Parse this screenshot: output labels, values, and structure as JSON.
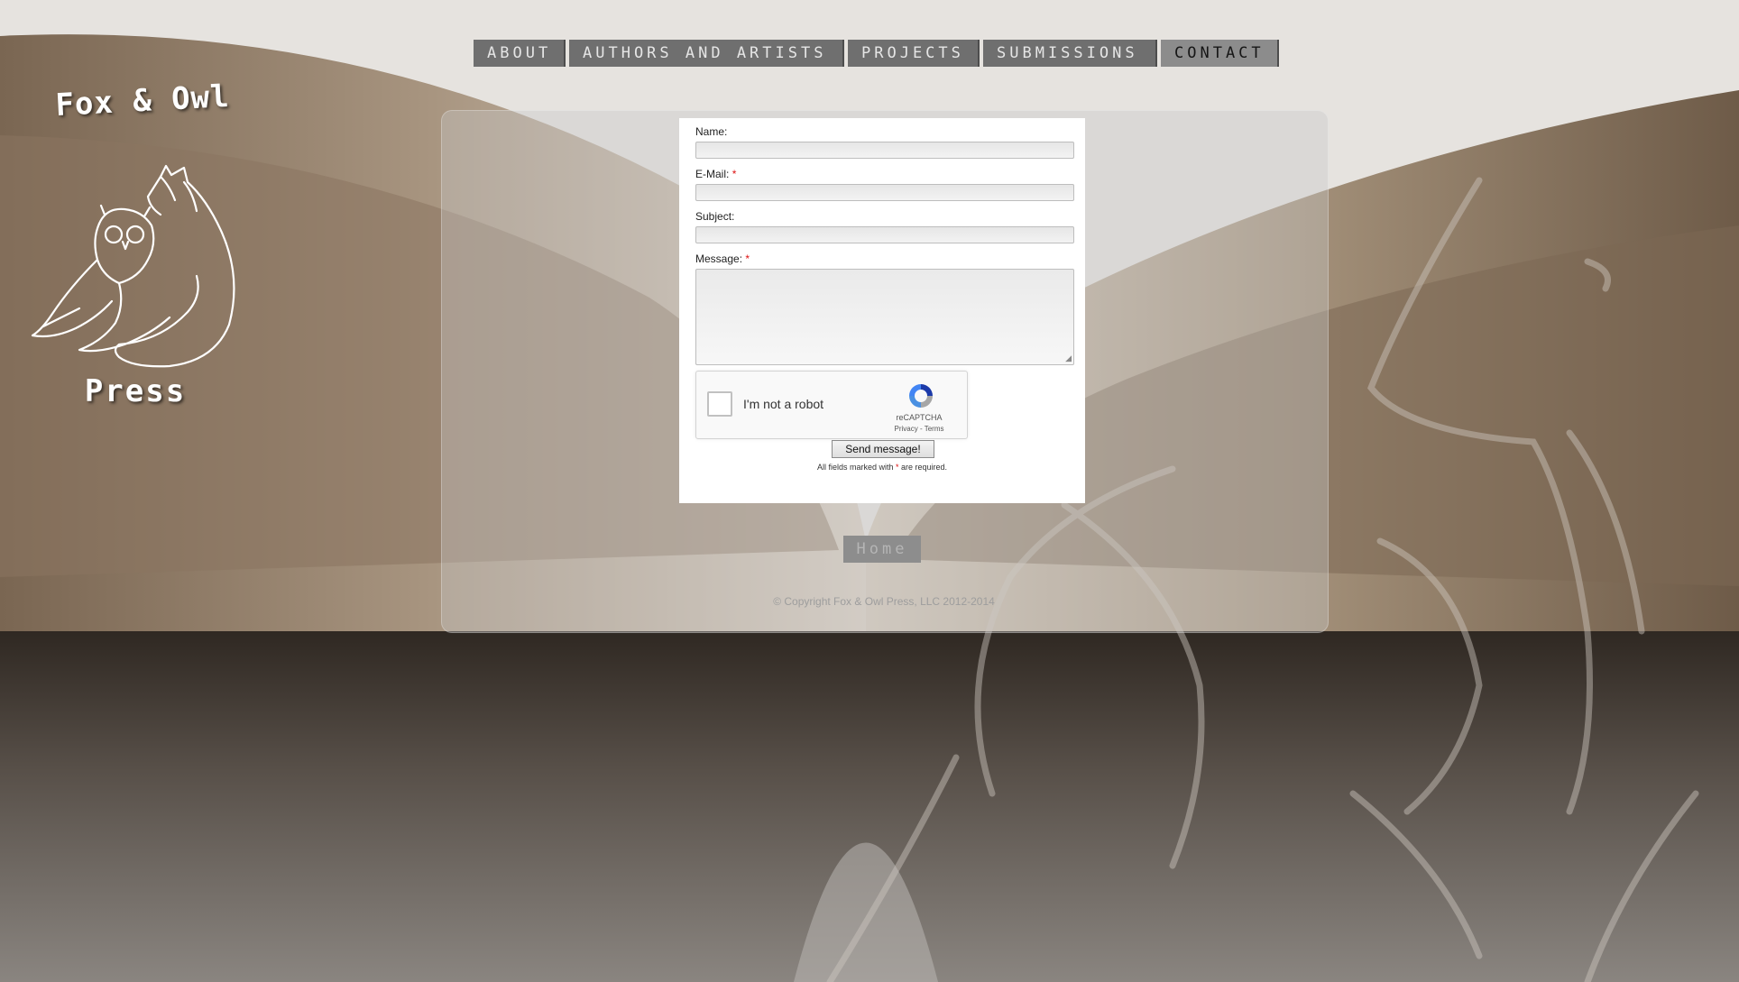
{
  "nav": {
    "items": [
      {
        "label": "About"
      },
      {
        "label": "Authors and Artists"
      },
      {
        "label": "Projects"
      },
      {
        "label": "Submissions"
      },
      {
        "label": "Contact",
        "active": true
      }
    ]
  },
  "logo": {
    "top_text": "Fox & Owl",
    "bottom_text": "Press"
  },
  "form": {
    "name_label": "Name:",
    "email_label": "E-Mail:",
    "subject_label": "Subject:",
    "message_label": "Message:",
    "required_mark": "*",
    "name_value": "",
    "email_value": "",
    "subject_value": "",
    "message_value": "",
    "send_label": "Send message!",
    "required_note_prefix": "All fields marked with ",
    "required_note_suffix": " are required."
  },
  "recaptcha": {
    "label": "I'm not a robot",
    "brand": "reCAPTCHA",
    "links": "Privacy - Terms",
    "checked": false
  },
  "footer": {
    "home_label": "Home",
    "copyright": "© Copyright Fox & Owl Press, LLC 2012-2014"
  },
  "colors": {
    "nav_bg": "#6f6f6f",
    "nav_active_bg": "#8c8c8c",
    "required": "#dd1111"
  }
}
